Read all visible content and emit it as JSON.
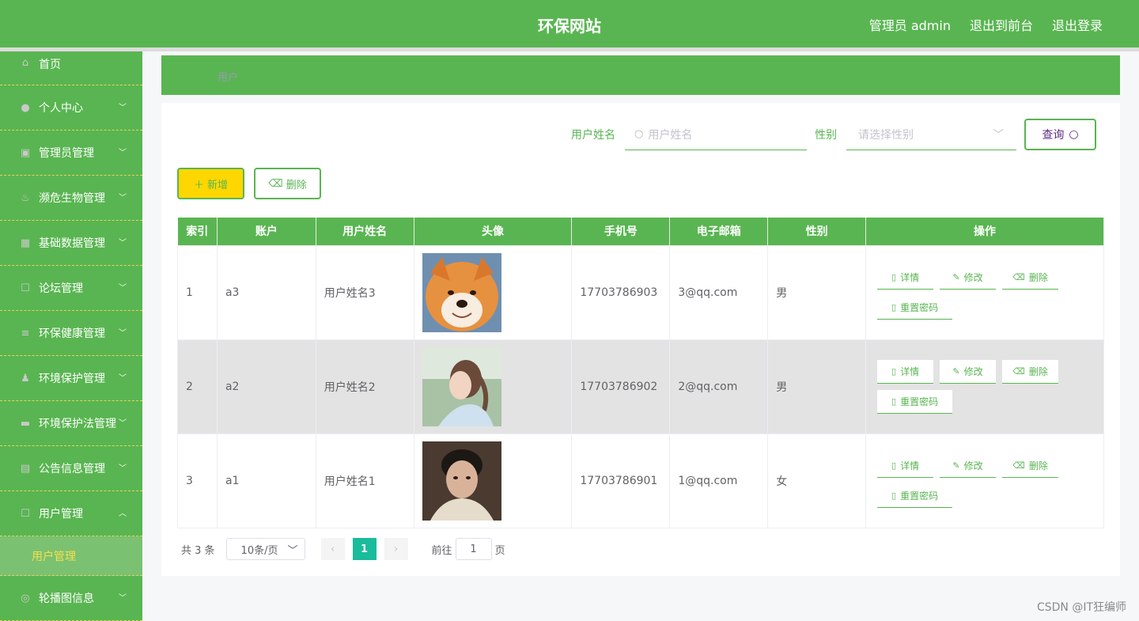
{
  "header": {
    "title": "环保网站",
    "admin_label": "管理员 admin",
    "to_front": "退出到前台",
    "logout": "退出登录"
  },
  "sidebar": {
    "items": [
      {
        "label": "首页",
        "icon": "home-icon"
      },
      {
        "label": "个人中心",
        "icon": "user-icon"
      },
      {
        "label": "管理员管理",
        "icon": "admin-icon"
      },
      {
        "label": "濒危生物管理",
        "icon": "bio-icon"
      },
      {
        "label": "基础数据管理",
        "icon": "data-icon"
      },
      {
        "label": "论坛管理",
        "icon": "forum-icon"
      },
      {
        "label": "环保健康管理",
        "icon": "health-icon"
      },
      {
        "label": "环境保护管理",
        "icon": "env-icon"
      },
      {
        "label": "环境保护法管理",
        "icon": "law-icon"
      },
      {
        "label": "公告信息管理",
        "icon": "notice-icon"
      },
      {
        "label": "用户管理",
        "icon": "users-icon"
      }
    ],
    "sub_active": "用户管理",
    "last": {
      "label": "轮播图信息",
      "icon": "carousel-icon"
    }
  },
  "breadcrumb": "用户",
  "search": {
    "name_label": "用户姓名",
    "name_placeholder": "用户姓名",
    "gender_label": "性别",
    "gender_placeholder": "请选择性别",
    "query_label": "查询"
  },
  "actions": {
    "add": "新增",
    "delete": "删除"
  },
  "table": {
    "headers": [
      "索引",
      "账户",
      "用户姓名",
      "头像",
      "手机号",
      "电子邮箱",
      "性别",
      "操作"
    ],
    "rows": [
      {
        "index": "1",
        "account": "a3",
        "name": "用户姓名3",
        "avatar": "shiba-dog",
        "phone": "17703786903",
        "email": "3@qq.com",
        "gender": "男"
      },
      {
        "index": "2",
        "account": "a2",
        "name": "用户姓名2",
        "avatar": "girl-profile",
        "phone": "17703786902",
        "email": "2@qq.com",
        "gender": "男"
      },
      {
        "index": "3",
        "account": "a1",
        "name": "用户姓名1",
        "avatar": "boy-selfie",
        "phone": "17703786901",
        "email": "1@qq.com",
        "gender": "女"
      }
    ],
    "op_labels": {
      "detail": "详情",
      "edit": "修改",
      "delete": "删除",
      "reset": "重置密码"
    }
  },
  "pagination": {
    "total": "共 3 条",
    "page_size": "10条/页",
    "current": "1",
    "goto_prefix": "前往",
    "goto_value": "1",
    "goto_suffix": "页"
  },
  "watermark": "CSDN @IT狂编师",
  "colors": {
    "primary": "#59b551",
    "accent": "#ffd700",
    "pager": "#1abc9c"
  }
}
